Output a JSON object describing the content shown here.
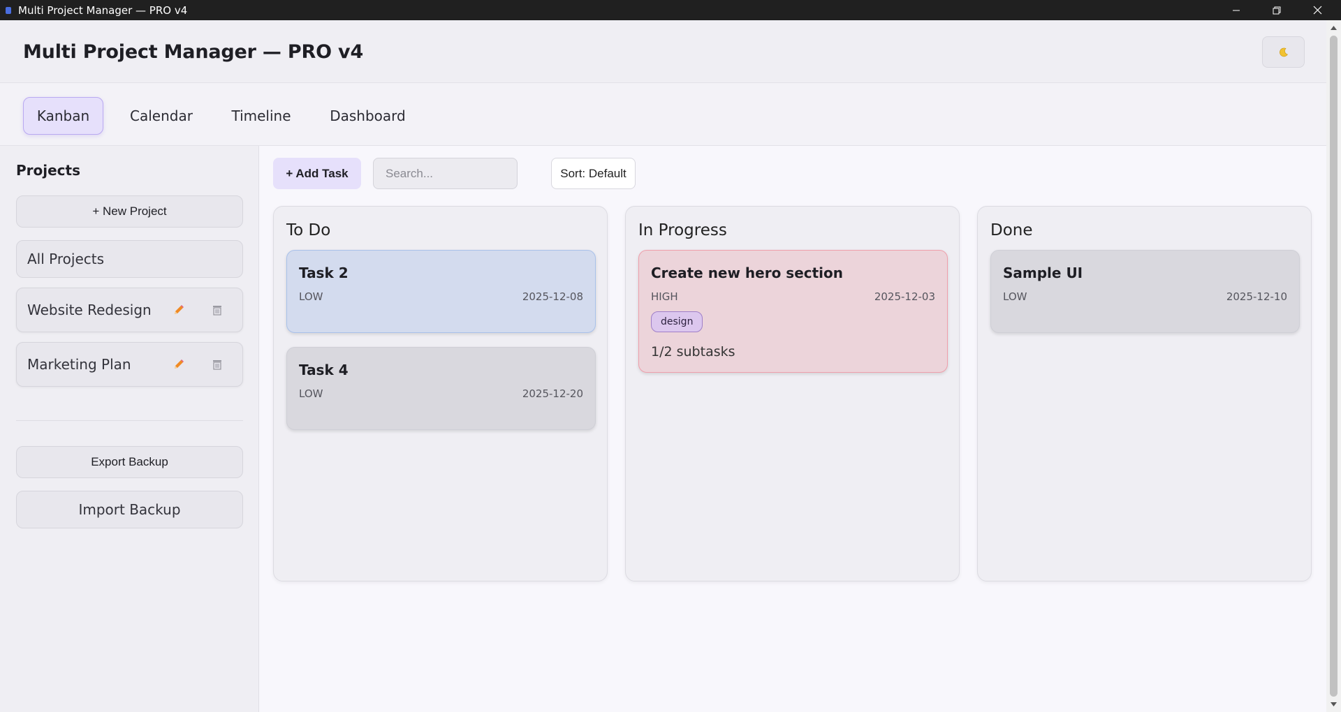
{
  "window": {
    "title": "Multi Project Manager — PRO v4"
  },
  "header": {
    "title": "Multi Project Manager — PRO v4",
    "theme_icon": "moon-icon"
  },
  "tabs": [
    {
      "label": "Kanban",
      "active": true
    },
    {
      "label": "Calendar",
      "active": false
    },
    {
      "label": "Timeline",
      "active": false
    },
    {
      "label": "Dashboard",
      "active": false
    }
  ],
  "sidebar": {
    "heading": "Projects",
    "new_project_label": "+ New Project",
    "all_projects_label": "All Projects",
    "projects": [
      {
        "name": "Website Redesign",
        "edit_icon": "pencil-icon",
        "delete_icon": "trash-icon"
      },
      {
        "name": "Marketing Plan",
        "edit_icon": "pencil-icon",
        "delete_icon": "trash-icon"
      }
    ],
    "export_label": "Export Backup",
    "import_label": "Import Backup"
  },
  "toolbar": {
    "add_task_label": "+ Add Task",
    "search_placeholder": "Search...",
    "search_value": "",
    "sort_label": "Sort: Default"
  },
  "columns": [
    {
      "title": "To Do",
      "cards": [
        {
          "title": "Task 2",
          "priority": "LOW",
          "due": "2025-12-08",
          "color": "#d3dbee"
        },
        {
          "title": "Task 4",
          "priority": "LOW",
          "due": "2025-12-20",
          "color": "#d9d8de"
        }
      ]
    },
    {
      "title": "In Progress",
      "cards": [
        {
          "title": "Create new hero section",
          "priority": "HIGH",
          "due": "2025-12-03",
          "tag": "design",
          "subtasks": "1/2 subtasks",
          "color": "#ecd4da"
        }
      ]
    },
    {
      "title": "Done",
      "cards": [
        {
          "title": "Sample UI",
          "priority": "LOW",
          "due": "2025-12-10",
          "color": "#d9d8de"
        }
      ]
    }
  ],
  "colors": {
    "accent": "#e6e0fb",
    "accent_border": "#b9a9f1",
    "high_priority": "#ecd4da",
    "selected_card": "#d3dbee"
  }
}
